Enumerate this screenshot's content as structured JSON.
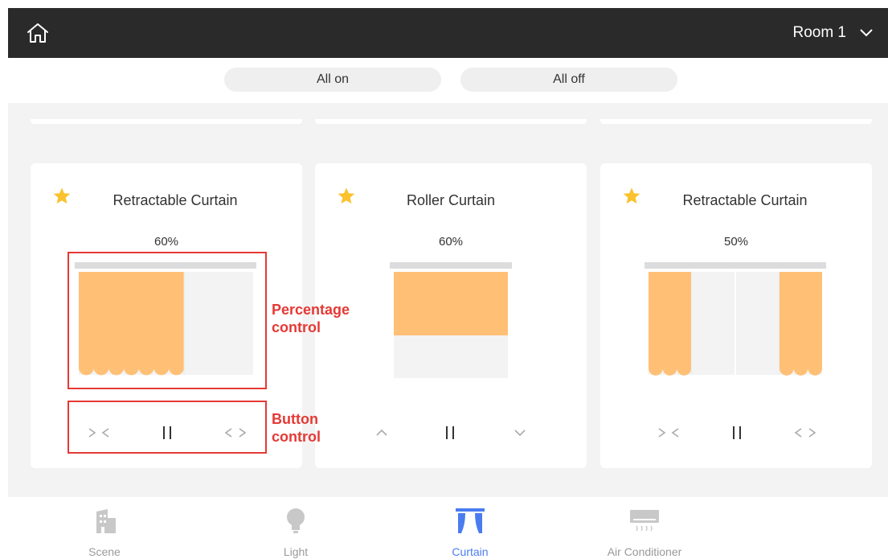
{
  "header": {
    "room": "Room 1"
  },
  "actions": {
    "all_on": "All on",
    "all_off": "All off"
  },
  "cards": [
    {
      "name": "Retractable Curtain",
      "percent": "60%",
      "type": "retractable",
      "value": 0.6,
      "favorite": true
    },
    {
      "name": "Roller Curtain",
      "percent": "60%",
      "type": "roller",
      "value": 0.6,
      "favorite": true
    },
    {
      "name": "Retractable Curtain",
      "percent": "50%",
      "type": "retractable",
      "value": 0.5,
      "favorite": true
    }
  ],
  "annotations": {
    "percentage": "Percentage\ncontrol",
    "button": "Button\ncontrol"
  },
  "nav": [
    {
      "label": "Scene",
      "icon": "building-icon",
      "active": false
    },
    {
      "label": "Light",
      "icon": "bulb-icon",
      "active": false
    },
    {
      "label": "Curtain",
      "icon": "curtain-icon",
      "active": true
    },
    {
      "label": "Air Conditioner",
      "icon": "air-conditioner-icon",
      "active": false
    }
  ],
  "colors": {
    "topbar": "#2a2a2a",
    "curtain": "#ffc076",
    "star": "#f9c22e",
    "annotation": "#e53935",
    "active": "#4a7cf0"
  }
}
